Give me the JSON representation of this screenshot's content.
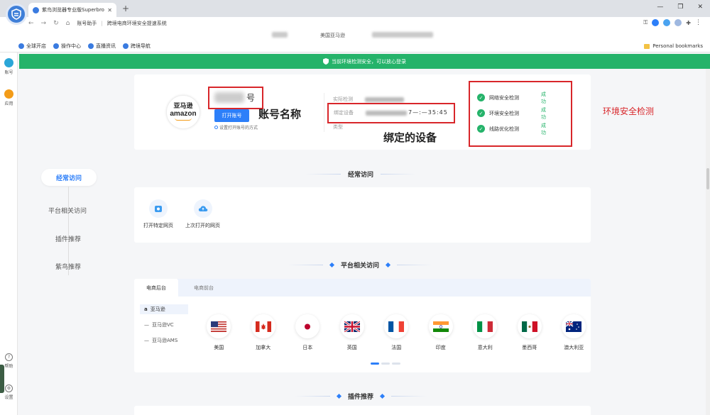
{
  "browser": {
    "tab_title": "紫鸟浏览器专业版Superbrowser",
    "tab_close": "✕",
    "new_tab": "+",
    "window_controls": [
      "—",
      "❐",
      "✕"
    ]
  },
  "address_bar": {
    "account_label": "账号助手",
    "page_title": "跨境电商环境安全提速系统"
  },
  "info_strip": {
    "platform": "美国亚马逊"
  },
  "bookmarks": {
    "items": [
      "全球开店",
      "操作中心",
      "直播资讯",
      "跨境导航"
    ],
    "personal": "Personal bookmarks"
  },
  "rail": {
    "account": "账号",
    "apps": "应用",
    "help": "帮助",
    "settings": "设置"
  },
  "banner": {
    "text": "当前环境检测安全，可以放心登录"
  },
  "account": {
    "logo_cn": "亚马逊",
    "logo_en": "amazon",
    "name_suffix": "号",
    "open_button": "打开账号",
    "open_hint": "设置打开账号的方式",
    "fields": {
      "real_check": "实际检测",
      "bound_device": "绑定设备",
      "type": "类型"
    },
    "device_suffix": "7—:—35:45"
  },
  "annotations": {
    "account_name": "账号名称",
    "bound_device": "绑定的设备",
    "env_check": "环境安全检测"
  },
  "checks": [
    {
      "label": "网络安全检测",
      "status": "成功"
    },
    {
      "label": "环境安全检测",
      "status": "成功"
    },
    {
      "label": "线路优化检测",
      "status": "成功"
    }
  ],
  "sidenav": {
    "items": [
      "经常访问",
      "平台相关访问",
      "插件推荐",
      "紫鸟推荐"
    ]
  },
  "sections": {
    "frequent": "经常访问",
    "platform": "平台相关访问",
    "plugins": "插件推荐"
  },
  "frequent": [
    {
      "label": "打开特定网页",
      "icon": "open-page-icon"
    },
    {
      "label": "上次打开的网页",
      "icon": "cloud-icon"
    }
  ],
  "platform": {
    "tabs": [
      "电商后台",
      "电商前台"
    ],
    "sites": [
      "亚马逊",
      "亚马逊VC",
      "亚马逊AMS"
    ],
    "countries": [
      "美国",
      "加拿大",
      "日本",
      "英国",
      "法国",
      "印度",
      "意大利",
      "墨西哥",
      "澳大利亚"
    ]
  },
  "colors": {
    "accent": "#2d7ff9",
    "banner_green": "#25b36a",
    "annotation_red": "#d8262a"
  }
}
